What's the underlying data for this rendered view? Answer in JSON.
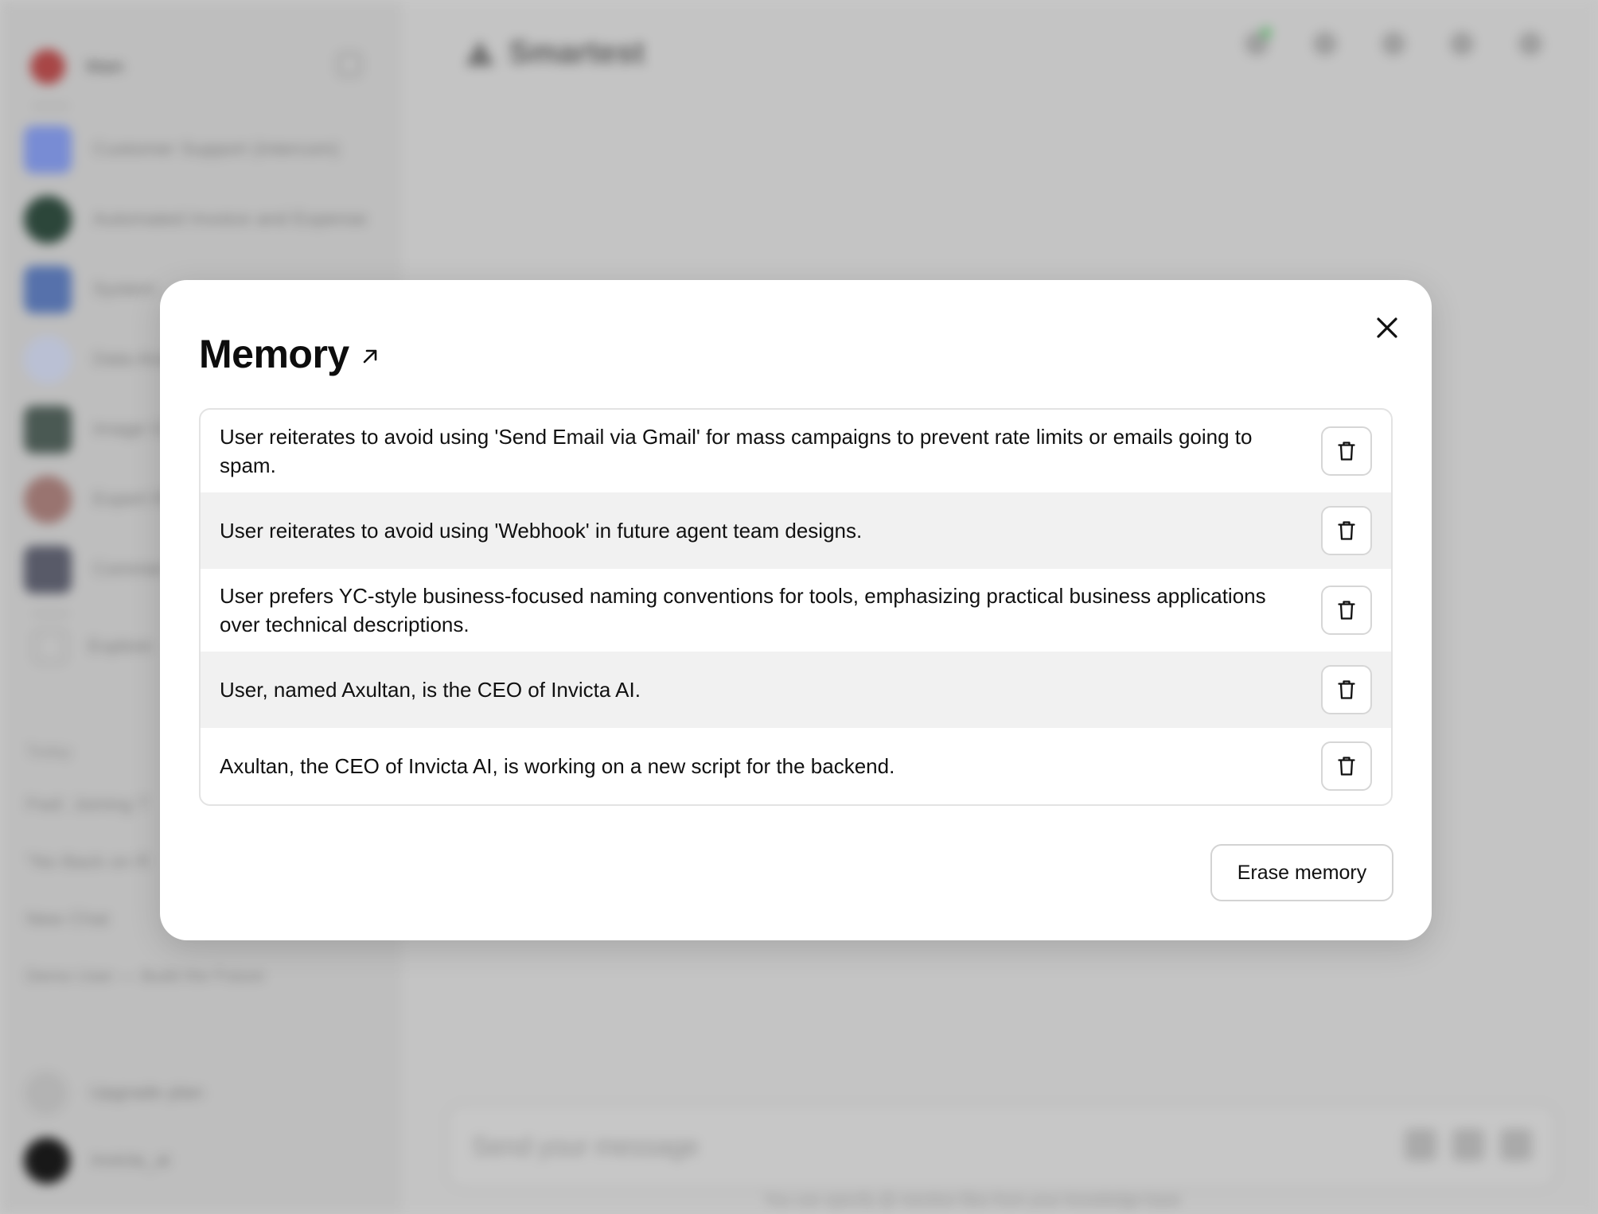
{
  "background": {
    "sidebar": {
      "top_label": "Main",
      "agents": [
        {
          "label": "Customer Support (Intercom)",
          "color": "#7f94e0"
        },
        {
          "label": "Automated Invoice and Expense",
          "color": "#2f4a3e"
        },
        {
          "label": "System",
          "color": "#5b78b5"
        },
        {
          "label": "Data Ana",
          "color": "#c5cbe0"
        },
        {
          "label": "Image G",
          "color": "#4f5e58"
        },
        {
          "label": "Expert R",
          "color": "#a27b77"
        },
        {
          "label": "Commer",
          "color": "#5d5f6e"
        }
      ],
      "explore_label": "Explore",
      "section_label": "Today",
      "chats": [
        "Fwd: Joining T",
        "\"No Back on R",
        "New Chat",
        "Demo User — Build the Future"
      ],
      "upgrade_label": "Upgrade plan",
      "user_label": "invicta_ai"
    },
    "main": {
      "title": "Smartest",
      "composer_placeholder": "Send your message",
      "footnote": "You can specify @ mention files from your knowledge base"
    }
  },
  "modal": {
    "title": "Memory",
    "memories": [
      "User reiterates to avoid using 'Send Email via Gmail' for mass campaigns to prevent rate limits or emails going to spam.",
      "User reiterates to avoid using 'Webhook' in future agent team designs.",
      "User prefers YC-style business-focused naming conventions for tools, emphasizing practical business applications over technical descriptions.",
      "User, named Axultan, is the CEO of Invicta AI.",
      "Axultan, the CEO of Invicta AI, is working on a new script for the backend."
    ],
    "erase_label": "Erase memory",
    "icons": {
      "close": "close-icon",
      "external": "external-link-icon",
      "delete": "trash-icon"
    }
  }
}
